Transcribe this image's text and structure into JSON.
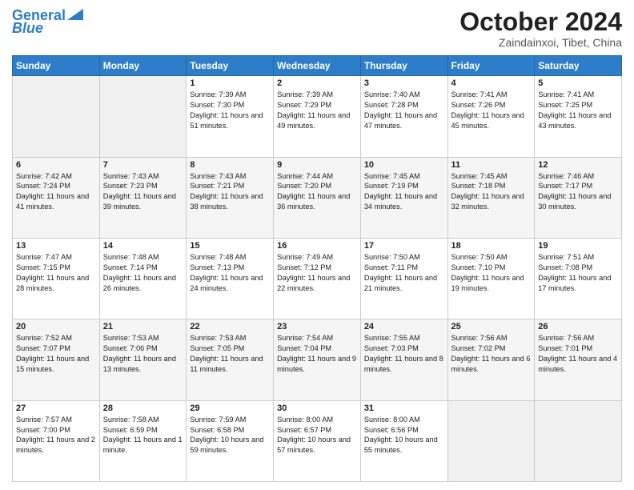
{
  "logo": {
    "line1": "General",
    "line2": "Blue"
  },
  "title": "October 2024",
  "location": "Zaindainxoi, Tibet, China",
  "weekdays": [
    "Sunday",
    "Monday",
    "Tuesday",
    "Wednesday",
    "Thursday",
    "Friday",
    "Saturday"
  ],
  "weeks": [
    [
      {
        "day": "",
        "info": ""
      },
      {
        "day": "",
        "info": ""
      },
      {
        "day": "1",
        "info": "Sunrise: 7:39 AM\nSunset: 7:30 PM\nDaylight: 11 hours and 51 minutes."
      },
      {
        "day": "2",
        "info": "Sunrise: 7:39 AM\nSunset: 7:29 PM\nDaylight: 11 hours and 49 minutes."
      },
      {
        "day": "3",
        "info": "Sunrise: 7:40 AM\nSunset: 7:28 PM\nDaylight: 11 hours and 47 minutes."
      },
      {
        "day": "4",
        "info": "Sunrise: 7:41 AM\nSunset: 7:26 PM\nDaylight: 11 hours and 45 minutes."
      },
      {
        "day": "5",
        "info": "Sunrise: 7:41 AM\nSunset: 7:25 PM\nDaylight: 11 hours and 43 minutes."
      }
    ],
    [
      {
        "day": "6",
        "info": "Sunrise: 7:42 AM\nSunset: 7:24 PM\nDaylight: 11 hours and 41 minutes."
      },
      {
        "day": "7",
        "info": "Sunrise: 7:43 AM\nSunset: 7:23 PM\nDaylight: 11 hours and 39 minutes."
      },
      {
        "day": "8",
        "info": "Sunrise: 7:43 AM\nSunset: 7:21 PM\nDaylight: 11 hours and 38 minutes."
      },
      {
        "day": "9",
        "info": "Sunrise: 7:44 AM\nSunset: 7:20 PM\nDaylight: 11 hours and 36 minutes."
      },
      {
        "day": "10",
        "info": "Sunrise: 7:45 AM\nSunset: 7:19 PM\nDaylight: 11 hours and 34 minutes."
      },
      {
        "day": "11",
        "info": "Sunrise: 7:45 AM\nSunset: 7:18 PM\nDaylight: 11 hours and 32 minutes."
      },
      {
        "day": "12",
        "info": "Sunrise: 7:46 AM\nSunset: 7:17 PM\nDaylight: 11 hours and 30 minutes."
      }
    ],
    [
      {
        "day": "13",
        "info": "Sunrise: 7:47 AM\nSunset: 7:15 PM\nDaylight: 11 hours and 28 minutes."
      },
      {
        "day": "14",
        "info": "Sunrise: 7:48 AM\nSunset: 7:14 PM\nDaylight: 11 hours and 26 minutes."
      },
      {
        "day": "15",
        "info": "Sunrise: 7:48 AM\nSunset: 7:13 PM\nDaylight: 11 hours and 24 minutes."
      },
      {
        "day": "16",
        "info": "Sunrise: 7:49 AM\nSunset: 7:12 PM\nDaylight: 11 hours and 22 minutes."
      },
      {
        "day": "17",
        "info": "Sunrise: 7:50 AM\nSunset: 7:11 PM\nDaylight: 11 hours and 21 minutes."
      },
      {
        "day": "18",
        "info": "Sunrise: 7:50 AM\nSunset: 7:10 PM\nDaylight: 11 hours and 19 minutes."
      },
      {
        "day": "19",
        "info": "Sunrise: 7:51 AM\nSunset: 7:08 PM\nDaylight: 11 hours and 17 minutes."
      }
    ],
    [
      {
        "day": "20",
        "info": "Sunrise: 7:52 AM\nSunset: 7:07 PM\nDaylight: 11 hours and 15 minutes."
      },
      {
        "day": "21",
        "info": "Sunrise: 7:53 AM\nSunset: 7:06 PM\nDaylight: 11 hours and 13 minutes."
      },
      {
        "day": "22",
        "info": "Sunrise: 7:53 AM\nSunset: 7:05 PM\nDaylight: 11 hours and 11 minutes."
      },
      {
        "day": "23",
        "info": "Sunrise: 7:54 AM\nSunset: 7:04 PM\nDaylight: 11 hours and 9 minutes."
      },
      {
        "day": "24",
        "info": "Sunrise: 7:55 AM\nSunset: 7:03 PM\nDaylight: 11 hours and 8 minutes."
      },
      {
        "day": "25",
        "info": "Sunrise: 7:56 AM\nSunset: 7:02 PM\nDaylight: 11 hours and 6 minutes."
      },
      {
        "day": "26",
        "info": "Sunrise: 7:56 AM\nSunset: 7:01 PM\nDaylight: 11 hours and 4 minutes."
      }
    ],
    [
      {
        "day": "27",
        "info": "Sunrise: 7:57 AM\nSunset: 7:00 PM\nDaylight: 11 hours and 2 minutes."
      },
      {
        "day": "28",
        "info": "Sunrise: 7:58 AM\nSunset: 6:59 PM\nDaylight: 11 hours and 1 minute."
      },
      {
        "day": "29",
        "info": "Sunrise: 7:59 AM\nSunset: 6:58 PM\nDaylight: 10 hours and 59 minutes."
      },
      {
        "day": "30",
        "info": "Sunrise: 8:00 AM\nSunset: 6:57 PM\nDaylight: 10 hours and 57 minutes."
      },
      {
        "day": "31",
        "info": "Sunrise: 8:00 AM\nSunset: 6:56 PM\nDaylight: 10 hours and 55 minutes."
      },
      {
        "day": "",
        "info": ""
      },
      {
        "day": "",
        "info": ""
      }
    ]
  ]
}
